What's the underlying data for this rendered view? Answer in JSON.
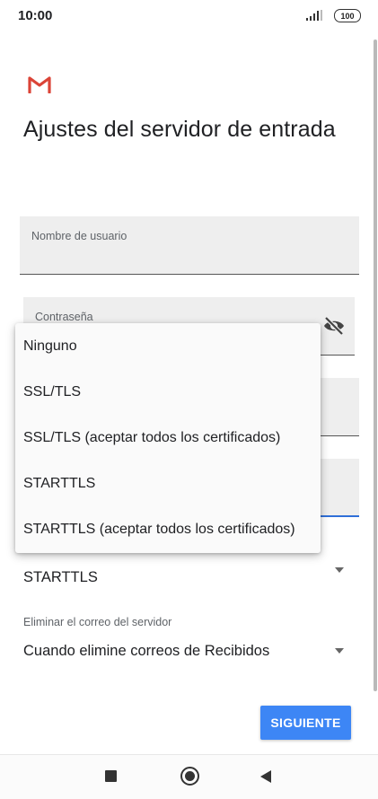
{
  "status_bar": {
    "time": "10:00",
    "battery": "100",
    "signal_icon": "signal-bars-icon",
    "battery_icon": "battery-icon"
  },
  "app": {
    "logo_icon": "gmail-logo-icon",
    "brand_color": "#db4437"
  },
  "page": {
    "title": "Ajustes del servidor de entrada"
  },
  "fields": {
    "username": {
      "label": "Nombre de usuario",
      "value": ""
    },
    "password": {
      "label": "Contraseña",
      "value": "",
      "toggle_icon": "visibility-off-icon"
    },
    "server": {
      "label": "",
      "value": ""
    },
    "port": {
      "label": "",
      "value": ""
    }
  },
  "security": {
    "selected": "STARTTLS",
    "options": [
      "Ninguno",
      "SSL/TLS",
      "SSL/TLS (aceptar todos los certificados)",
      "STARTTLS",
      "STARTTLS (aceptar todos los certificados)"
    ]
  },
  "delete_policy": {
    "label": "Eliminar el correo del servidor",
    "selected": "Cuando elimine correos de Recibidos"
  },
  "actions": {
    "next_label": "SIGUIENTE",
    "accent_color": "#3d86f5"
  },
  "nav": {
    "recents_icon": "recents-square-icon",
    "home_icon": "home-circle-icon",
    "back_icon": "back-triangle-icon"
  }
}
